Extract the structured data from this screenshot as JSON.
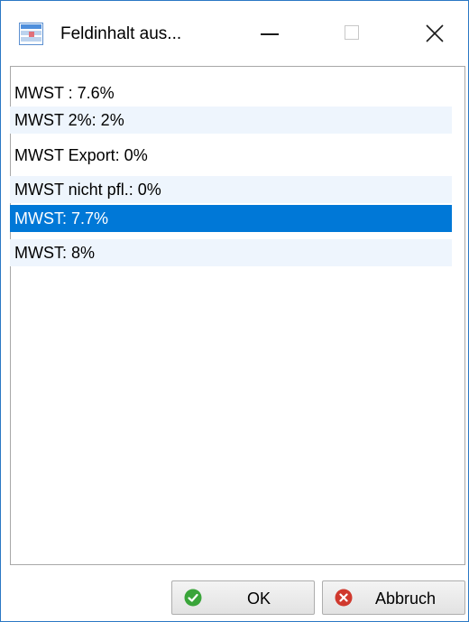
{
  "window": {
    "title": "Feldinhalt aus...",
    "accent": "#2b78c4"
  },
  "list": {
    "items": [
      {
        "label": "MWST : 7.6%",
        "selected": false
      },
      {
        "label": "MWST 2%: 2%",
        "selected": false
      },
      {
        "label": "MWST Export: 0%",
        "selected": false
      },
      {
        "label": "MWST nicht pfl.: 0%",
        "selected": false
      },
      {
        "label": "MWST: 7.7%",
        "selected": true
      },
      {
        "label": "MWST: 8%",
        "selected": false
      }
    ],
    "selection_color": "#0078d7",
    "alt_row_color": "#eef5fd"
  },
  "buttons": {
    "ok_label": "OK",
    "ok_icon": "check-circle-icon",
    "cancel_label": "Abbruch",
    "cancel_icon": "x-circle-icon"
  }
}
